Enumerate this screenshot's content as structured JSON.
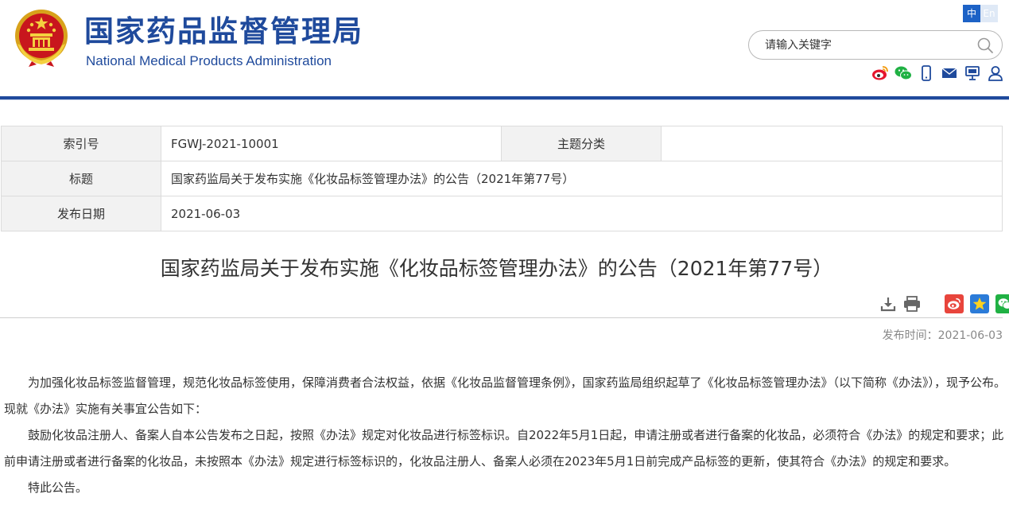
{
  "header": {
    "site_name_cn": "国家药品监督管理局",
    "site_name_en": "National Medical Products Administration",
    "lang_cn": "中",
    "lang_en": "En",
    "search_placeholder": "请输入关键字",
    "share_icons": [
      "weibo-icon",
      "wechat-icon",
      "mobile-icon",
      "mail-icon",
      "screen-icon",
      "user-icon"
    ]
  },
  "meta": {
    "index_label": "索引号",
    "index_value": "FGWJ-2021-10001",
    "category_label": "主题分类",
    "category_value": "",
    "title_label": "标题",
    "title_value": "国家药监局关于发布实施《化妆品标签管理办法》的公告（2021年第77号）",
    "date_label": "发布日期",
    "date_value": "2021-06-03"
  },
  "article": {
    "title": "国家药监局关于发布实施《化妆品标签管理办法》的公告（2021年第77号）",
    "pub_time_label": "发布时间：",
    "pub_time_value": "2021-06-03",
    "paragraphs": [
      "为加强化妆品标签监督管理，规范化妆品标签使用，保障消费者合法权益，依据《化妆品监督管理条例》，国家药监局组织起草了《化妆品标签管理办法》（以下简称《办法》），现予公布。现就《办法》实施有关事宜公告如下：",
      "鼓励化妆品注册人、备案人自本公告发布之日起，按照《办法》规定对化妆品进行标签标识。自2022年5月1日起，申请注册或者进行备案的化妆品，必须符合《办法》的规定和要求；此前申请注册或者进行备案的化妆品，未按照本《办法》规定进行标签标识的，化妆品注册人、备案人必须在2023年5月1日前完成产品标签的更新，使其符合《办法》的规定和要求。",
      "特此公告。"
    ]
  },
  "colors": {
    "brand_blue": "#1f4a9c",
    "lang_active": "#1d62c6",
    "weibo_red": "#e6162d",
    "wechat_green": "#20b144",
    "star_blue": "#2b7bd8"
  }
}
